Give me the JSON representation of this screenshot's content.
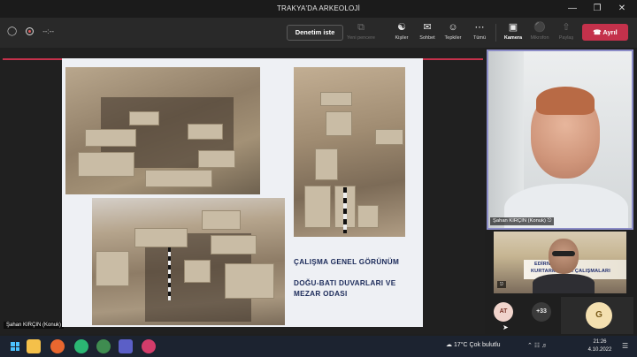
{
  "window": {
    "title": "TRAKYA'DA ARKEOLOJİ",
    "controls": [
      "minimize",
      "maximize",
      "close"
    ]
  },
  "toolbar": {
    "timer": "--:--",
    "audit_button": "Denetim iste",
    "items": [
      {
        "key": "new_window",
        "label": "Yeni pencere",
        "icon": "new-window-icon",
        "enabled": false
      },
      {
        "key": "people",
        "label": "Kişiler",
        "icon": "people-icon",
        "enabled": true
      },
      {
        "key": "chat",
        "label": "Sohbet",
        "icon": "chat-icon",
        "enabled": true
      },
      {
        "key": "reactions",
        "label": "Tepkiler",
        "icon": "reactions-icon",
        "enabled": true
      },
      {
        "key": "more",
        "label": "Tümü",
        "icon": "more-icon",
        "enabled": true
      },
      {
        "key": "camera",
        "label": "Kamera",
        "icon": "camera-icon",
        "enabled": true,
        "bold": true
      },
      {
        "key": "mic",
        "label": "Mikrofon",
        "icon": "mic-off-icon",
        "enabled": false
      },
      {
        "key": "share",
        "label": "Paylaş",
        "icon": "share-icon",
        "enabled": false
      }
    ],
    "leave_button": "Ayrıl",
    "leave_color": "#c4314b"
  },
  "slide": {
    "caption_1": "ÇALIŞMA GENEL GÖRÜNÜM",
    "caption_2_line1": "DOĞU-BATI DUVARLARI VE",
    "caption_2_line2": "MEZAR ODASI",
    "caption_color": "#1c2b5a"
  },
  "presenter": {
    "stage_name": "Şahan KIRÇIN (Konuk)",
    "tile_name": "Şahan KIRÇIN (Konuk)",
    "highlight_color": "#8b8cc7"
  },
  "second_tile": {
    "banner_line1": "EDİRNE",
    "banner_line2": "KURTARMA KAZI ÇALIŞMALARI"
  },
  "participants": {
    "avatar_1": "AT",
    "overflow": "+33",
    "avatar_2": "G"
  },
  "taskbar": {
    "weather_temp": "17°C",
    "weather_text": "Çok bulutlu",
    "time": "21:26",
    "date": "4.10.2022"
  }
}
